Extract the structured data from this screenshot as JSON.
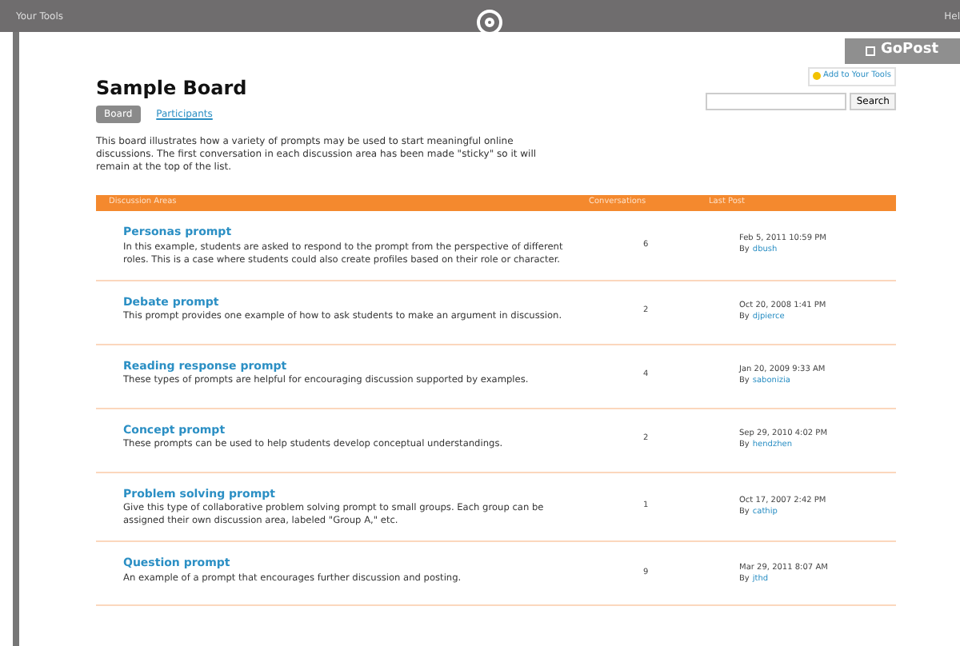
{
  "top_bar": {
    "left_link": "Your Tools",
    "right_link": "Hel"
  },
  "gopost": {
    "label": "GoPost"
  },
  "board": {
    "title": "Sample Board",
    "add_tools": "Add to Your Tools",
    "tabs": [
      {
        "label": "Board",
        "selected": true
      },
      {
        "label": "Participants",
        "selected": false
      }
    ],
    "search": {
      "button": "Search"
    },
    "description": "This board illustrates how a variety of prompts may be used to start meaningful online discussions. The first conversation in each discussion area has been made \"sticky\" so it will remain at the top of the list."
  },
  "table": {
    "columns": [
      "Discussion Areas",
      "Conversations",
      "Last Post"
    ],
    "rows": [
      {
        "title": "Personas prompt",
        "text": "In this example, students are asked to respond to the prompt from the perspective of different roles. This is a case where students could also create profiles based on their role or character.",
        "count": "6",
        "date": "Feb 5, 2011 10:59 PM",
        "by": "By",
        "author": "dbush"
      },
      {
        "title": "Debate prompt",
        "text": "This prompt provides one example of how to ask students to make an argument in discussion.",
        "count": "2",
        "date": "Oct 20, 2008 1:41 PM",
        "by": "By",
        "author": "djpierce"
      },
      {
        "title": "Reading response prompt",
        "text": "These types of prompts are helpful for encouraging discussion supported by examples.",
        "count": "4",
        "date": "Jan 20, 2009 9:33 AM",
        "by": "By",
        "author": "sabonizia"
      },
      {
        "title": "Concept prompt",
        "text": "These prompts can be used to help students develop conceptual understandings.",
        "count": "2",
        "date": "Sep 29, 2010 4:02 PM",
        "by": "By",
        "author": "hendzhen"
      },
      {
        "title": "Problem solving prompt",
        "text": "Give this type of collaborative problem solving prompt to small groups. Each group can be assigned their own discussion area, labeled \"Group A,\" etc.",
        "count": "1",
        "date": "Oct 17, 2007 2:42 PM",
        "by": "By",
        "author": "cathip"
      },
      {
        "title": "Question prompt",
        "text": "An example of a prompt that encourages further discussion and posting.",
        "count": "9",
        "date": "Mar 29, 2011 8:07 AM",
        "by": "By",
        "author": "jthd"
      }
    ]
  }
}
